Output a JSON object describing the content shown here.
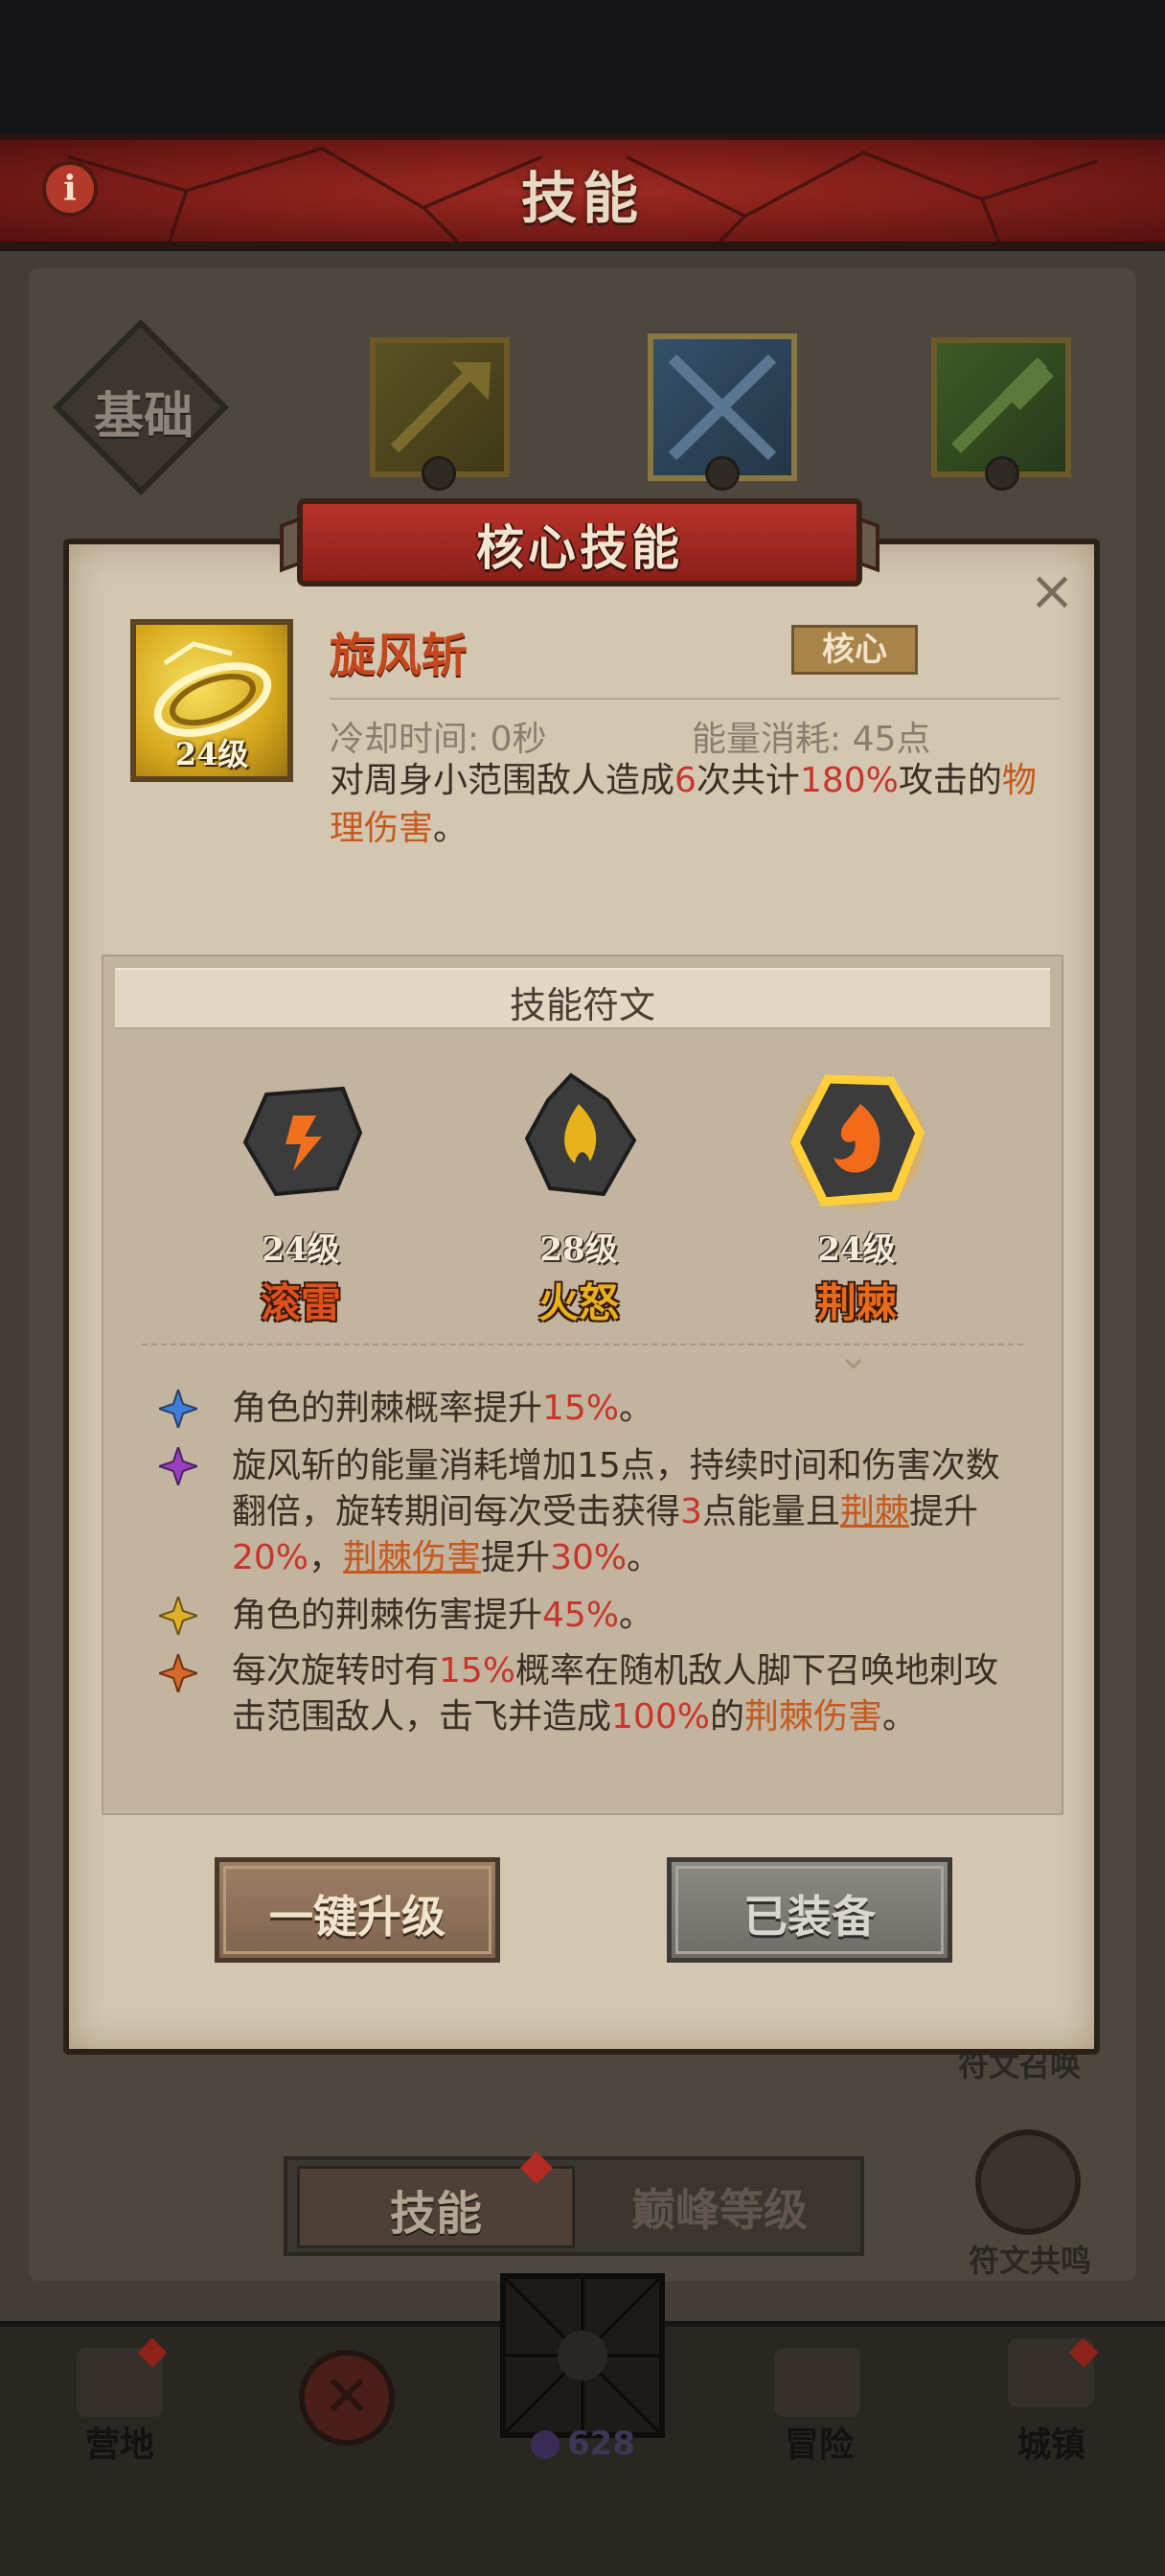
{
  "header": {
    "title": "技能",
    "info_icon": "info-icon",
    "info_glyph": "i"
  },
  "background": {
    "base_tab_label": "基础",
    "rune_summon_label": "符文召唤",
    "tab_skill": "技能",
    "tab_peak": "巅峰等级",
    "resonance_label": "符文共鸣"
  },
  "bottom_nav": {
    "camp": "营地",
    "adventure": "冒险",
    "town": "城镇",
    "gem_count": "628"
  },
  "modal": {
    "title": "核心技能",
    "close_glyph": "×",
    "skill": {
      "name": "旋风斩",
      "level": "24级",
      "badge": "核心",
      "cooldown": "冷却时间: 0秒",
      "energy": "能量消耗: 45点",
      "desc_1": "对周身小范围敌人造成",
      "desc_2": "6",
      "desc_3": "次共计",
      "desc_4": "180%",
      "desc_5": "攻击的",
      "desc_6": "物理伤害",
      "desc_7": "。"
    },
    "rune_section_title": "技能符文",
    "runes": [
      {
        "level": "24级",
        "name": "滚雷",
        "color": "#e0501e"
      },
      {
        "level": "28级",
        "name": "火怒",
        "color": "#e8b21c"
      },
      {
        "level": "24级",
        "name": "荆棘",
        "color": "#e86a1a",
        "selected": true
      }
    ],
    "effects": [
      {
        "star": "blue-star-icon",
        "color": "#3d7fd6",
        "parts": [
          "角色的荆棘概率提升",
          "15%",
          "。"
        ]
      },
      {
        "star": "purple-star-icon",
        "color": "#9a3fc2",
        "parts": [
          "旋风斩的能量消耗增加15点，持续时间和伤害次数翻倍，旋转期间每次受击获得",
          "3",
          "点能量且",
          "荆棘",
          "提升",
          "20%",
          "，",
          "荆棘伤害",
          "提升",
          "30%",
          "。"
        ]
      },
      {
        "star": "gold-star-icon",
        "color": "#e0b02a",
        "parts": [
          "角色的荆棘伤害提升",
          "45%",
          "。"
        ]
      },
      {
        "star": "orange-star-icon",
        "color": "#d9692a",
        "parts": [
          "每次旋转时有",
          "15%",
          "概率在随机敌人脚下召唤地刺攻击范围敌人，击飞并造成",
          "100%",
          "的",
          "荆棘伤害",
          "。"
        ]
      }
    ],
    "buttons": {
      "upgrade": "一键升级",
      "equipped": "已装备"
    }
  }
}
